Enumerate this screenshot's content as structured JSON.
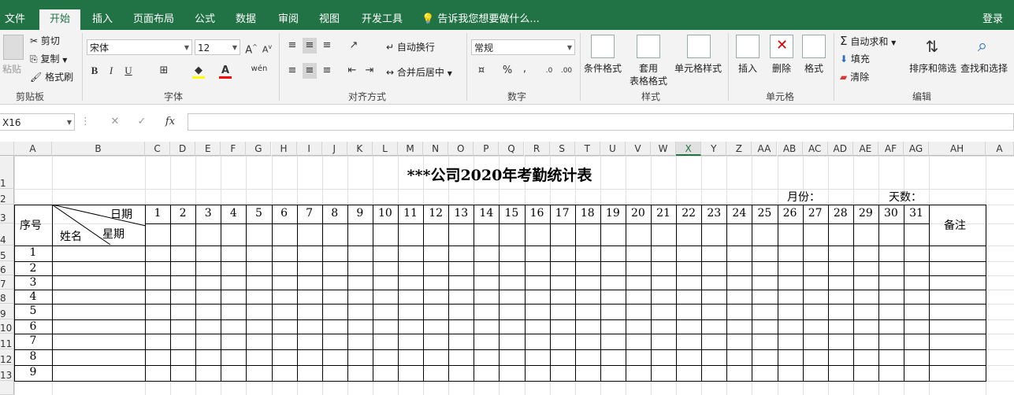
{
  "ribbon_tabs": [
    "文件",
    "开始",
    "插入",
    "页面布局",
    "公式",
    "数据",
    "审阅",
    "视图",
    "开发工具"
  ],
  "active_tab": "开始",
  "tell_me": "告诉我您想要做什么...",
  "login": "登录",
  "clipboard": {
    "paste": "粘贴",
    "cut": "剪切",
    "copy": "复制",
    "format_painter": "格式刷",
    "label": "剪贴板"
  },
  "font": {
    "name": "宋体",
    "size": "12",
    "bold": "B",
    "italic": "I",
    "underline": "U",
    "phonetic": "wén",
    "label": "字体"
  },
  "alignment": {
    "wrap": "自动换行",
    "merge": "合并后居中",
    "label": "对齐方式"
  },
  "number": {
    "format": "常规",
    "percent": "%",
    "comma": ",",
    "label": "数字"
  },
  "styles": {
    "conditional": "条件格式",
    "table_a": "套用",
    "table_b": "表格格式",
    "cell_styles": "单元格样式",
    "label": "样式"
  },
  "cells": {
    "insert": "插入",
    "delete": "删除",
    "format": "格式",
    "label": "单元格"
  },
  "editing": {
    "autosum": "自动求和",
    "fill": "填充",
    "clear": "清除",
    "sort": "排序和筛选",
    "find": "查找和选择",
    "label": "编辑"
  },
  "formula_bar": {
    "name_box": "X16",
    "fx": "fx",
    "value": ""
  },
  "columns": [
    "A",
    "B",
    "C",
    "D",
    "E",
    "F",
    "G",
    "H",
    "I",
    "J",
    "K",
    "L",
    "M",
    "N",
    "O",
    "P",
    "Q",
    "R",
    "S",
    "T",
    "U",
    "V",
    "W",
    "X",
    "Y",
    "Z",
    "AA",
    "AB",
    "AC",
    "AD",
    "AE",
    "AF",
    "AG",
    "AH",
    "A"
  ],
  "selected_column": "X",
  "rows": [
    "1",
    "2",
    "3",
    "4",
    "5",
    "6",
    "7",
    "8",
    "9",
    "10",
    "11",
    "12",
    "13"
  ],
  "sheet": {
    "title": "***公司2020年考勤统计表",
    "month_label": "月份：",
    "days_label": "天数：",
    "seq_header": "序号",
    "date_label": "日期",
    "weekday_label": "星期",
    "name_label": "姓名",
    "remarks_header": "备注",
    "days": [
      "1",
      "2",
      "3",
      "4",
      "5",
      "6",
      "7",
      "8",
      "9",
      "10",
      "11",
      "12",
      "13",
      "14",
      "15",
      "16",
      "17",
      "18",
      "19",
      "20",
      "21",
      "22",
      "23",
      "24",
      "25",
      "26",
      "27",
      "28",
      "29",
      "30",
      "31"
    ],
    "row_numbers": [
      "1",
      "2",
      "3",
      "4",
      "5",
      "6",
      "7",
      "8",
      "9"
    ]
  }
}
